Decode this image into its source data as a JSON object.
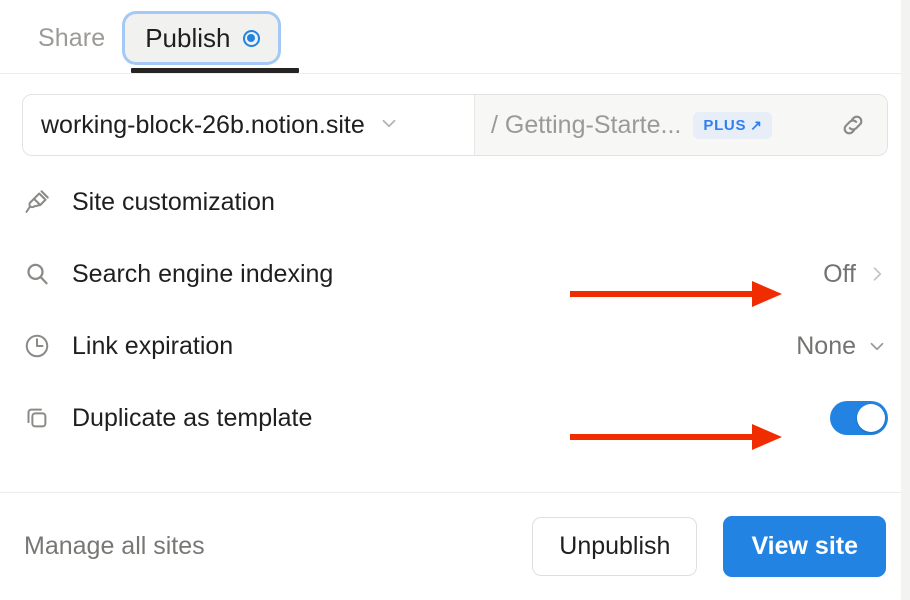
{
  "tabs": [
    {
      "id": "share",
      "label": "Share",
      "selected": false
    },
    {
      "id": "publish",
      "label": "Publish",
      "selected": true
    }
  ],
  "url_bar": {
    "domain": "working-block-26b.notion.site",
    "domain_chevron_icon": "chevron-down-icon",
    "path": "/ Getting-Starte...",
    "badge": {
      "label": "PLUS",
      "arrow": "↗",
      "bg": "#e7eef8",
      "fg": "#2f80ed"
    },
    "link_icon": "link-icon"
  },
  "settings": [
    {
      "id": "site-customization",
      "icon": "paintbrush-icon",
      "label": "Site customization",
      "value": "",
      "control": "none"
    },
    {
      "id": "search-engine-indexing",
      "icon": "search-icon",
      "label": "Search engine indexing",
      "value": "Off",
      "control": "chevron-right"
    },
    {
      "id": "link-expiration",
      "icon": "clock-icon",
      "label": "Link expiration",
      "value": "None",
      "control": "chevron-down"
    },
    {
      "id": "duplicate-as-template",
      "icon": "duplicate-icon",
      "label": "Duplicate as template",
      "value": "",
      "control": "toggle",
      "toggle_on": true
    }
  ],
  "footer": {
    "manage_label": "Manage all sites",
    "unpublish_label": "Unpublish",
    "view_site_label": "View site"
  },
  "annotations": {
    "color": "#f02d00",
    "arrows": [
      {
        "id": "arrow-to-search-engine-indexing",
        "target": "Off"
      },
      {
        "id": "arrow-to-duplicate-toggle",
        "target": "Duplicate as template toggle"
      }
    ]
  },
  "colors": {
    "accent_blue": "#2383e2",
    "annotation_red": "#f02d00",
    "tab_focus_ring": "#a5c9f5",
    "text_primary": "#1f1f1f",
    "text_muted": "#9b9a97"
  }
}
